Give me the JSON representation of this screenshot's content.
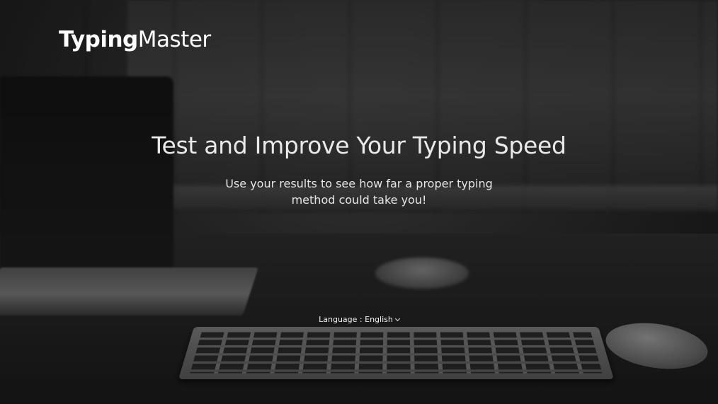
{
  "logo": {
    "bold_part": "Typing",
    "light_part": "Master"
  },
  "hero": {
    "headline": "Test and Improve Your Typing Speed",
    "subline": "Use your results to see how far a proper typing method could take you!"
  },
  "language_selector": {
    "label": "Language :",
    "value": "English",
    "icon": "chevron-down-icon"
  },
  "colors": {
    "text": "#ffffff",
    "background_tint": "#1c1c1c"
  }
}
